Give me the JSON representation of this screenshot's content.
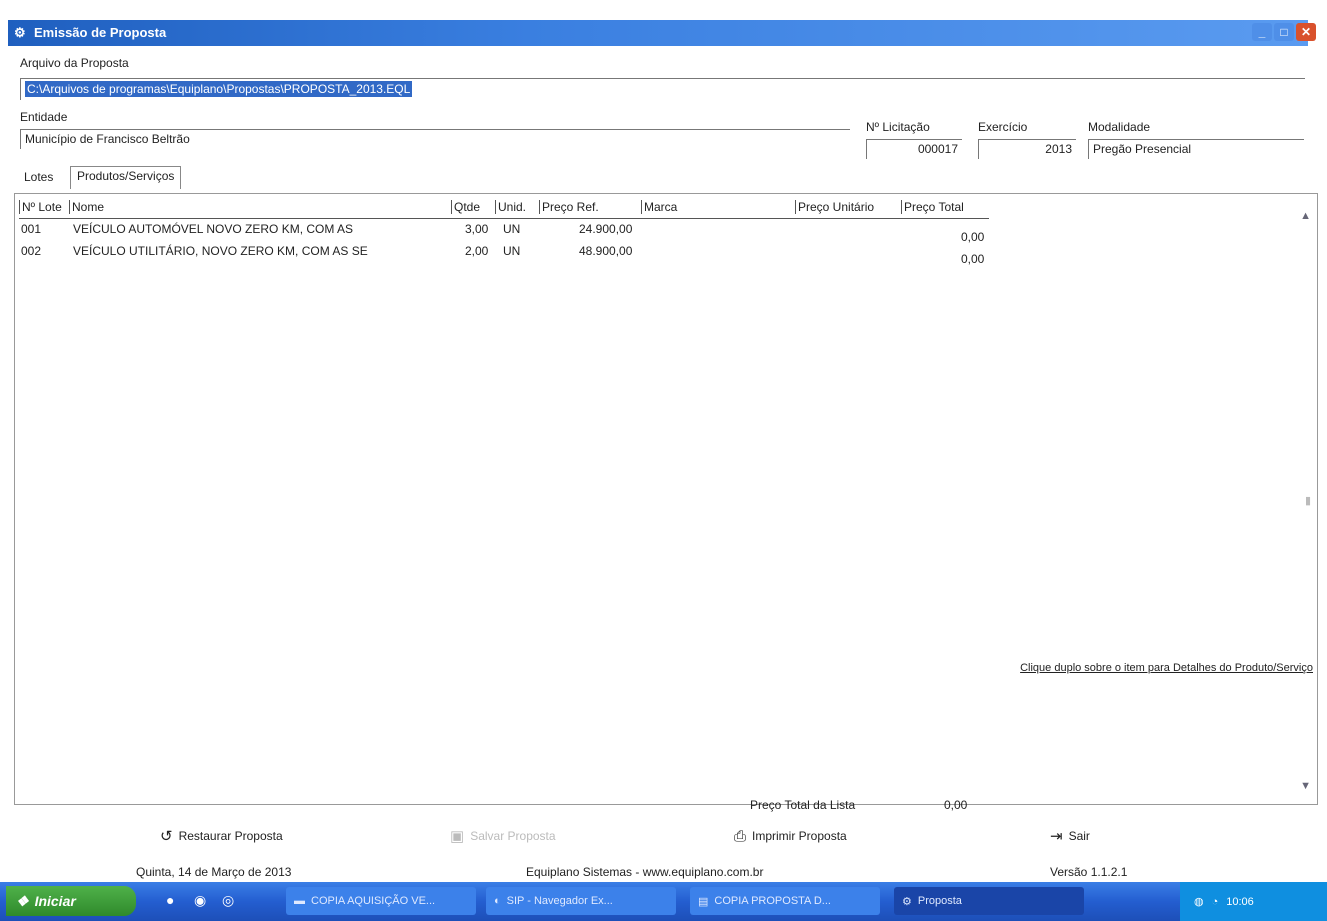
{
  "window": {
    "title": "Emissão de Proposta",
    "controls": {
      "minimize": "_",
      "maximize": "□",
      "close": "✕"
    }
  },
  "header": {
    "file_label": "Arquivo da Proposta",
    "file_value": "C:\\Arquivos de programas\\Equiplano\\Propostas\\PROPOSTA_2013.EQL",
    "entity_label": "Entidade",
    "entity_value": "Município de Francisco Beltrão",
    "licitacao_label": "Nº Licitação",
    "licitacao_value": "000017",
    "exercicio_label": "Exercício",
    "exercicio_value": "2013",
    "modalidade_label": "Modalidade",
    "modalidade_value": "Pregão Presencial"
  },
  "tabs": {
    "lines": "Lotes",
    "products": "Produtos/Serviços"
  },
  "grid": {
    "columns": [
      "Nº Lote",
      "Nome",
      "Qtde",
      "Unid.",
      "Preço Ref.",
      "Marca",
      "Preço Unitário",
      "Preço Total"
    ],
    "rows": [
      {
        "lote": "001",
        "nome": "VEÍCULO AUTOMÓVEL NOVO ZERO KM, COM AS",
        "qtde": "3,00",
        "unid": "UN",
        "preco_ref": "24.900,00",
        "preco_total": "0,00"
      },
      {
        "lote": "002",
        "nome": "VEÍCULO UTILITÁRIO, NOVO ZERO KM, COM AS SE",
        "qtde": "2,00",
        "unid": "UN",
        "preco_ref": "48.900,00",
        "preco_total": "0,00"
      }
    ],
    "hint": "Clique duplo sobre o item para Detalhes do Produto/Serviço",
    "total_label": "Preço Total da Lista",
    "total_value": "0,00"
  },
  "buttons": {
    "restore": "Restaurar Proposta",
    "disabled": "Salvar Proposta",
    "print": "Imprimir Proposta",
    "exit": "Sair"
  },
  "statusbar": {
    "date": "Quinta, 14 de Março de 2013",
    "company": "Equiplano Sistemas - www.equiplano.com.br",
    "version": "Versão 1.1.2.1"
  },
  "taskbar": {
    "start_label": "Iniciar",
    "tasks": [
      "COPIA AQUISIÇÃO VE...",
      "SIP - Navegador Ex...",
      "COPIA PROPOSTA D...",
      "Proposta"
    ],
    "clock": "10:06"
  },
  "colors": {
    "titlebar": "#2f6fd6",
    "selection": "#3169c6",
    "taskbar": "#245ed0",
    "start": "#3a9a36"
  }
}
